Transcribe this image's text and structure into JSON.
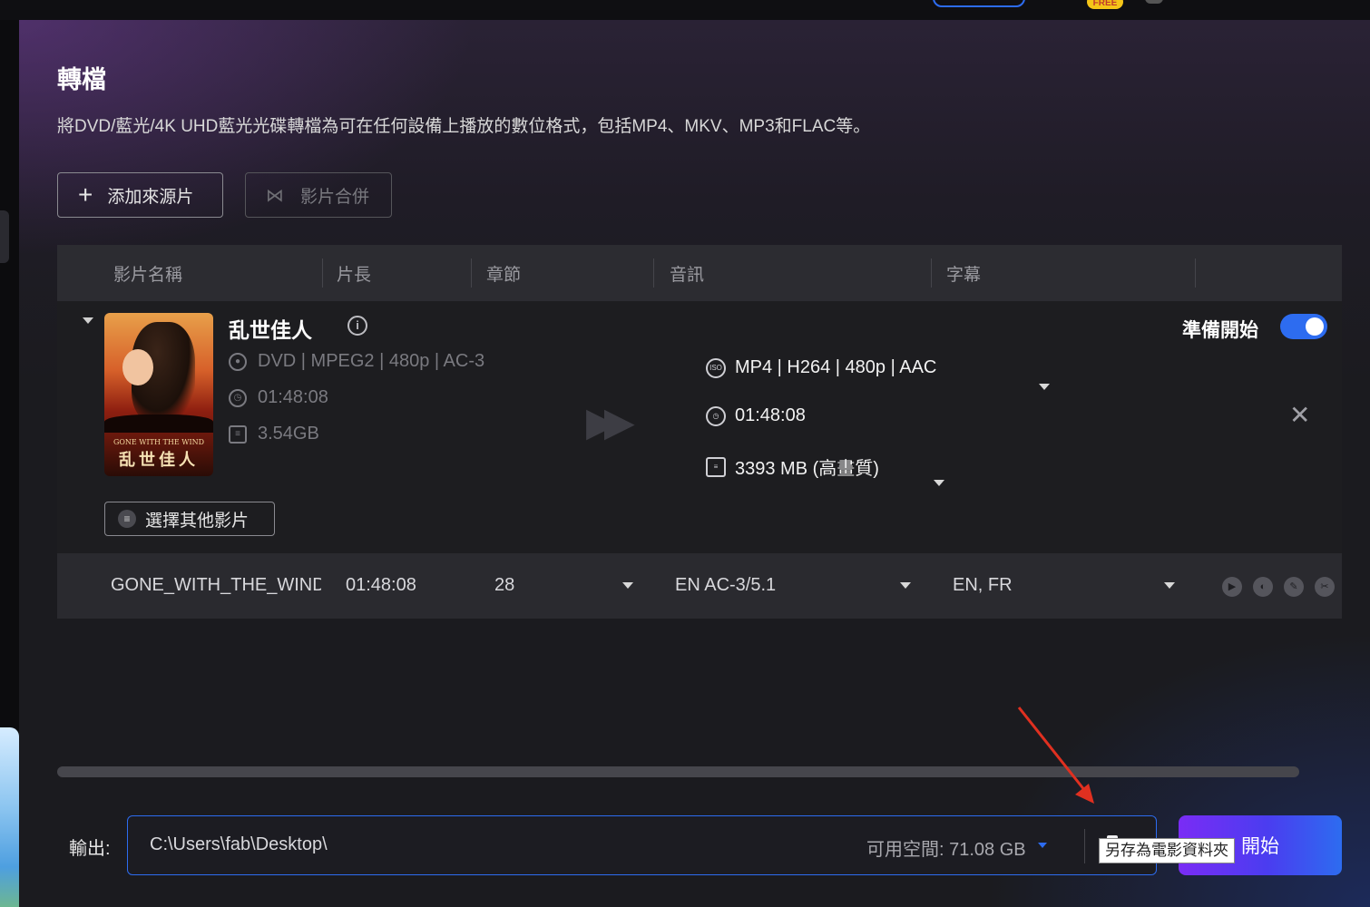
{
  "page": {
    "title": "轉檔",
    "subtitle": "將DVD/藍光/4K UHD藍光光碟轉檔為可在任何設備上播放的數位格式，包括MP4、MKV、MP3和FLAC等。"
  },
  "toolbar": {
    "add_source_label": "添加來源片",
    "merge_label": "影片合併"
  },
  "table": {
    "headers": [
      "影片名稱",
      "片長",
      "章節",
      "音訊",
      "字幕"
    ]
  },
  "movie": {
    "title": "乱世佳人",
    "poster_title_en": "GONE WITH THE WIND",
    "poster_title_zh": "乱世佳人",
    "source": {
      "format": "DVD | MPEG2 | 480p | AC-3",
      "duration": "01:48:08",
      "size": "3.54GB"
    },
    "output": {
      "format": "MP4 | H264 | 480p | AAC",
      "duration": "01:48:08",
      "size": "3393 MB (高畫質)"
    },
    "ready_label": "準備開始",
    "ready_enabled": true,
    "select_other_label": "選擇其他影片"
  },
  "title_row": {
    "name": "GONE_WITH_THE_WIND",
    "duration": "01:48:08",
    "chapters": "28",
    "audio": "EN  AC-3/5.1",
    "subtitles": "EN, FR"
  },
  "output_bar": {
    "label": "輸出:",
    "path": "C:\\Users\\fab\\Desktop\\",
    "free_space": "可用空間: 71.08 GB",
    "start_label": "開始",
    "tooltip": "另存為電影資料夾"
  },
  "colors": {
    "accent": "#2d6cf0",
    "start_gradient_from": "#7a2cf5",
    "annotation_arrow": "#e03020"
  },
  "icons": {
    "add": "plus-icon",
    "merge": "merge-icon",
    "info": "info-icon",
    "close": "close-icon",
    "folder": "folder-icon"
  }
}
